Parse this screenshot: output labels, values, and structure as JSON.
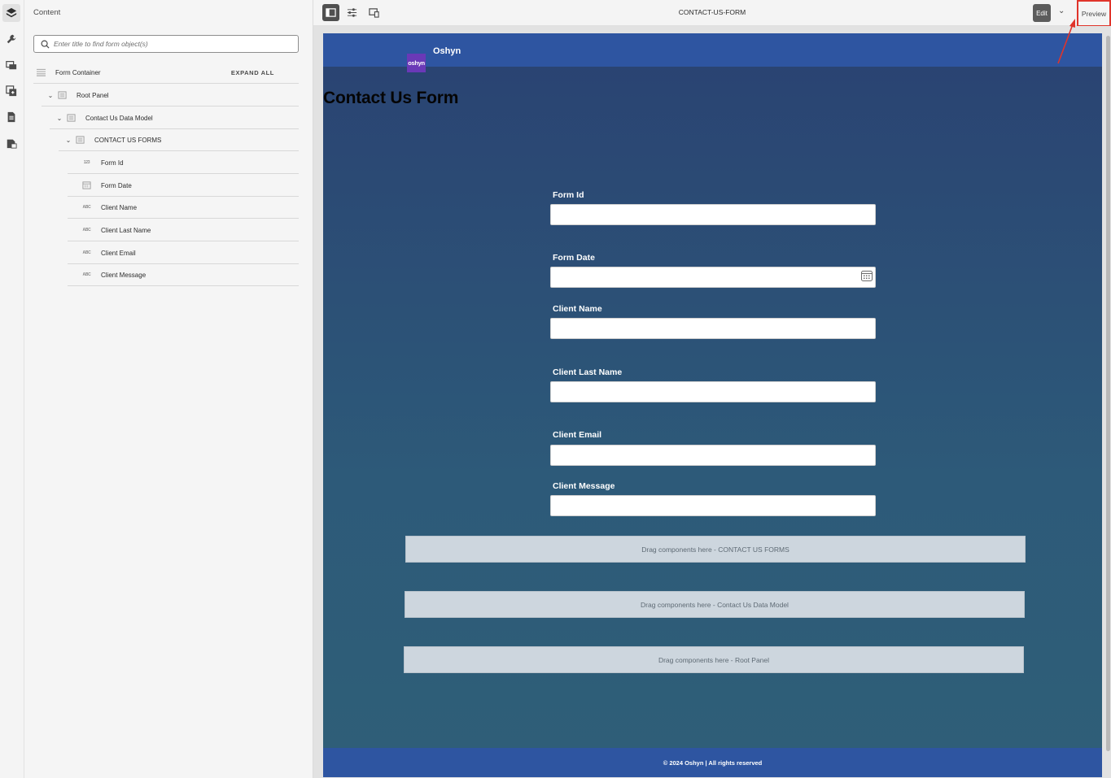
{
  "rail": {
    "icons": [
      "layers-icon",
      "wrench-icon",
      "assets-icon",
      "components-icon",
      "document-icon",
      "data-sources-icon"
    ]
  },
  "content_panel": {
    "title": "Content",
    "search_placeholder": "Enter title to find form object(s)",
    "expand_all": "EXPAND ALL",
    "tree": [
      {
        "label": "Form Container",
        "depth": 0,
        "icon": "container-icon",
        "expandable": false
      },
      {
        "label": "Root Panel",
        "depth": 1,
        "icon": "panel-icon",
        "expandable": true
      },
      {
        "label": "Contact Us Data Model",
        "depth": 2,
        "icon": "panel-icon",
        "expandable": true
      },
      {
        "label": "CONTACT US FORMS",
        "depth": 3,
        "icon": "panel-icon",
        "expandable": true
      },
      {
        "label": "Form Id",
        "depth": 4,
        "icon_text": "123",
        "expandable": false
      },
      {
        "label": "Form Date",
        "depth": 4,
        "icon": "date-icon",
        "expandable": false
      },
      {
        "label": "Client Name",
        "depth": 4,
        "icon_text": "ABC",
        "expandable": false
      },
      {
        "label": "Client Last Name",
        "depth": 4,
        "icon_text": "ABC",
        "expandable": false
      },
      {
        "label": "Client Email",
        "depth": 4,
        "icon_text": "ABC",
        "expandable": false
      },
      {
        "label": "Client Message",
        "depth": 4,
        "icon_text": "ABC",
        "expandable": false
      }
    ]
  },
  "toolbar": {
    "title": "CONTACT-US-FORM",
    "edit_label": "Edit",
    "preview_label": "Preview"
  },
  "form_page": {
    "brand": "Oshyn",
    "logo_text": "oshyn",
    "title": "Contact Us Form",
    "fields": [
      {
        "label": "Form Id",
        "value": ""
      },
      {
        "label": "Form Date",
        "value": ""
      },
      {
        "label": "Client Name",
        "value": ""
      },
      {
        "label": "Client Last Name",
        "value": ""
      },
      {
        "label": "Client Email",
        "value": ""
      },
      {
        "label": "Client Message",
        "value": ""
      }
    ],
    "drop_zones": [
      "Drag components here - CONTACT US FORMS",
      "Drag components here - Contact Us Data Model",
      "Drag components here - Root Panel"
    ],
    "footer": "© 2024 Oshyn | All rights reserved"
  },
  "colors": {
    "header_blue": "#2e55a1",
    "logo_purple": "#6a39b7",
    "highlight_red": "#e0342b"
  }
}
